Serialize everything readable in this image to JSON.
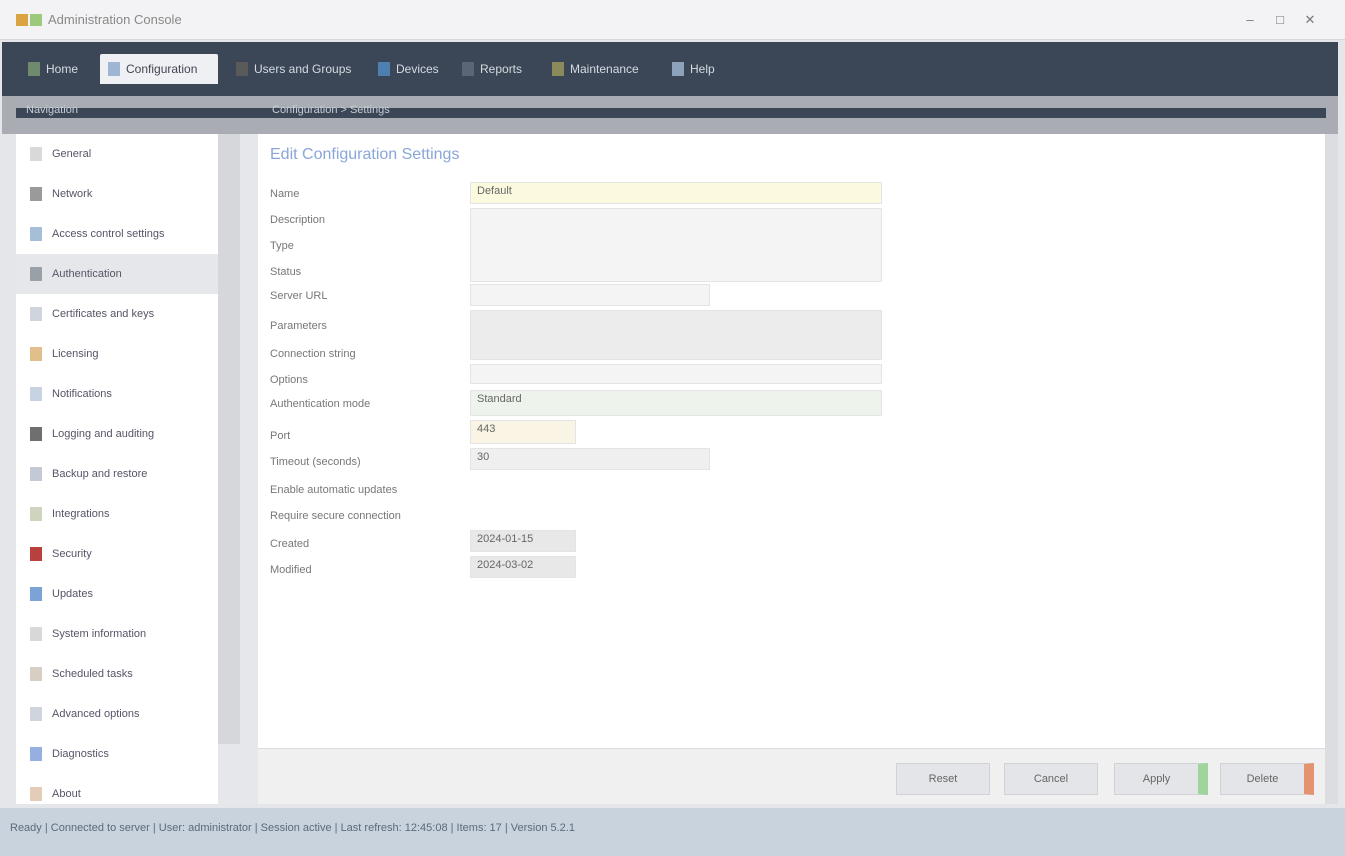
{
  "window": {
    "title": "Administration Console",
    "controls": {
      "minimize": "–",
      "maximize": "□",
      "close": "✕"
    }
  },
  "menubar": {
    "items": [
      {
        "label": "Home",
        "icon": "home-icon"
      },
      {
        "label": "Configuration",
        "icon": "gear-icon",
        "active": true
      },
      {
        "label": "Users and Groups",
        "icon": "users-icon"
      },
      {
        "label": "Devices",
        "icon": "device-icon"
      },
      {
        "label": "Reports",
        "icon": "report-icon"
      },
      {
        "label": "Maintenance",
        "icon": "wrench-icon"
      },
      {
        "label": "Help",
        "icon": "help-icon"
      }
    ]
  },
  "subbar": {
    "left": "Navigation",
    "crumb": "Configuration > Settings"
  },
  "sidebar": {
    "items": [
      {
        "label": "General",
        "icon_color": "#d9d9d9"
      },
      {
        "label": "Network",
        "icon_color": "#9a9a9a"
      },
      {
        "label": "Access control settings",
        "icon_color": "#a6bfd9"
      },
      {
        "label": "Authentication",
        "icon_color": "#9aa0a8",
        "active": true
      },
      {
        "label": "Certificates and keys",
        "icon_color": "#d0d4dc"
      },
      {
        "label": "Licensing",
        "icon_color": "#e2bf8a"
      },
      {
        "label": "Notifications",
        "icon_color": "#c7d3e3"
      },
      {
        "label": "Logging and auditing",
        "icon_color": "#6f6f6f"
      },
      {
        "label": "Backup and restore",
        "icon_color": "#c4c9d6"
      },
      {
        "label": "Integrations",
        "icon_color": "#cfd4bf"
      },
      {
        "label": "Security",
        "icon_color": "#b8413e"
      },
      {
        "label": "Updates",
        "icon_color": "#7ba3d8"
      },
      {
        "label": "System information",
        "icon_color": "#d8d8d8"
      },
      {
        "label": "Scheduled tasks",
        "icon_color": "#d8cfc4"
      },
      {
        "label": "Advanced options",
        "icon_color": "#d0d4dc"
      },
      {
        "label": "Diagnostics",
        "icon_color": "#95b0e0"
      },
      {
        "label": "About",
        "icon_color": "#e3cdb9"
      }
    ]
  },
  "content": {
    "heading": "Edit Configuration Settings",
    "fields": [
      {
        "label": "Name",
        "value": "Default",
        "style": "yellow"
      },
      {
        "label": "Description",
        "value": ""
      },
      {
        "label": "Type",
        "value": ""
      },
      {
        "label": "Status",
        "value": ""
      },
      {
        "label": "Server URL",
        "value": ""
      },
      {
        "label": "Parameters",
        "value": ""
      },
      {
        "label": "Connection string",
        "value": ""
      },
      {
        "label": "Options",
        "value": ""
      },
      {
        "label": "Authentication mode",
        "value": "Standard",
        "style": "green"
      },
      {
        "label": "Port",
        "value": "443",
        "style": "cream"
      },
      {
        "label": "Timeout (seconds)",
        "value": "30"
      },
      {
        "label": "Enable automatic updates",
        "value": ""
      },
      {
        "label": "Require secure connection",
        "value": ""
      },
      {
        "label": "Created",
        "value": "2024-01-15"
      },
      {
        "label": "Modified",
        "value": "2024-03-02"
      }
    ]
  },
  "footer": {
    "buttons": [
      "Reset",
      "Cancel",
      "Apply",
      "Delete"
    ]
  },
  "statusbar": {
    "text": "Ready  |  Connected to server  |  User: administrator  |  Session active  |  Last refresh: 12:45:08  |  Items: 17  |  Version 5.2.1"
  },
  "colors": {
    "menubar_bg": "#3b4656",
    "accent_blue": "#8aa6d8",
    "apply_green": "#9fd59a",
    "delete_orange": "#e4936f"
  }
}
